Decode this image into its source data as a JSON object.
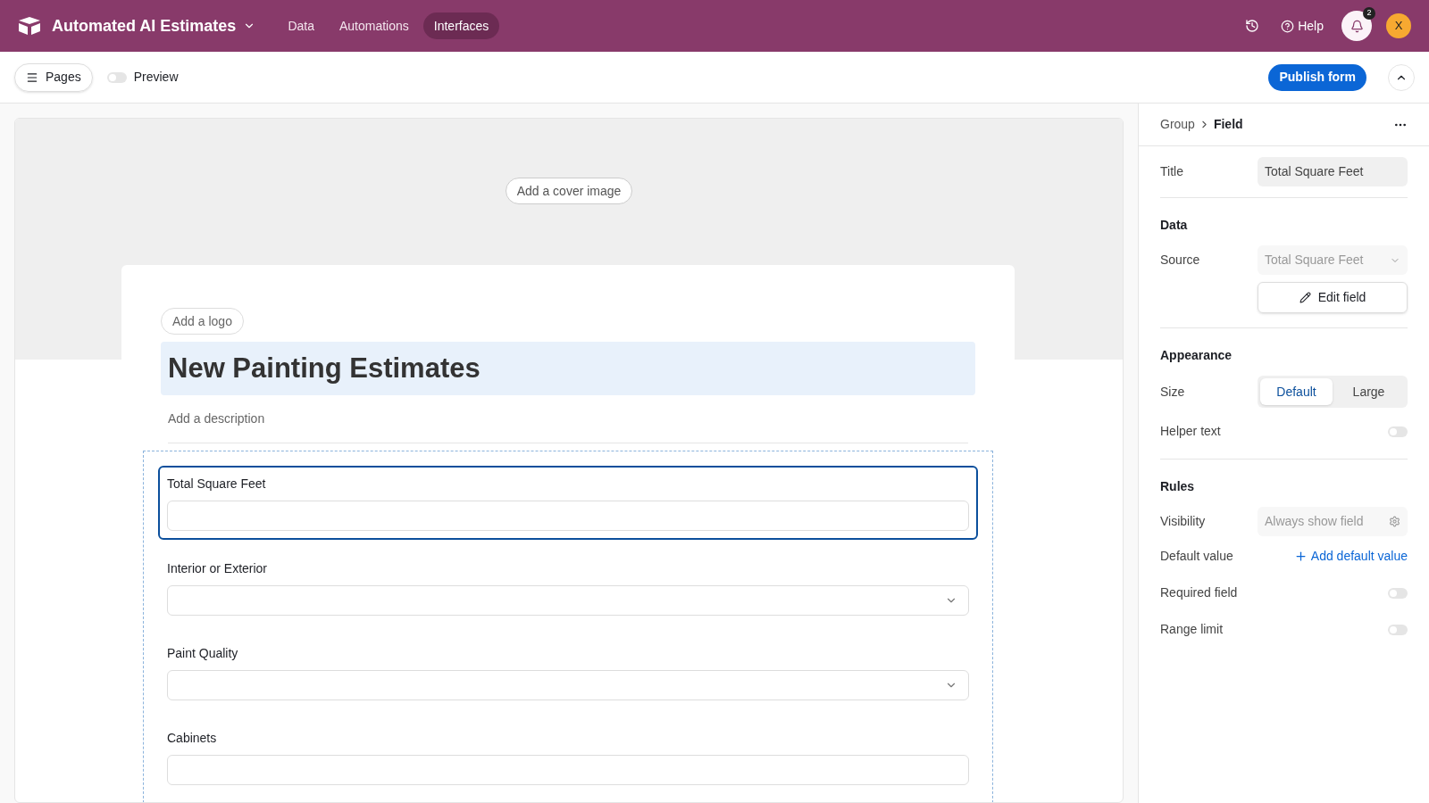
{
  "header": {
    "app_name": "Automated AI Estimates",
    "nav": [
      {
        "label": "Data",
        "selected": false
      },
      {
        "label": "Automations",
        "selected": false
      },
      {
        "label": "Interfaces",
        "selected": true
      }
    ],
    "help": "Help",
    "notification_count": "2",
    "avatar": "X"
  },
  "toolbar": {
    "pages": "Pages",
    "preview": {
      "label": "Preview",
      "on": false
    },
    "publish": "Publish form"
  },
  "form": {
    "cover_button": "Add a cover image",
    "logo_button": "Add a logo",
    "title": "New Painting Estimates",
    "description_placeholder": "Add a description",
    "fields": [
      {
        "label": "Total Square Feet",
        "kind": "text",
        "selected": true
      },
      {
        "label": "Interior or Exterior",
        "kind": "select",
        "selected": false
      },
      {
        "label": "Paint Quality",
        "kind": "select",
        "selected": false
      },
      {
        "label": "Cabinets",
        "kind": "text",
        "selected": false
      }
    ]
  },
  "panel": {
    "breadcrumb": [
      "Group",
      "Field"
    ],
    "title_label": "Title",
    "title_value": "Total Square Feet",
    "data_heading": "Data",
    "source_label": "Source",
    "source_value": "Total Square Feet",
    "edit_field": "Edit field",
    "appearance_heading": "Appearance",
    "size_label": "Size",
    "size_options": [
      {
        "label": "Default",
        "selected": true
      },
      {
        "label": "Large",
        "selected": false
      }
    ],
    "helper_text": {
      "label": "Helper text",
      "on": false
    },
    "rules_heading": "Rules",
    "visibility_label": "Visibility",
    "visibility_value": "Always show field",
    "default_value_label": "Default value",
    "add_default_value": "Add default value",
    "toggles": [
      {
        "label": "Required field",
        "on": false
      },
      {
        "label": "Range limit",
        "on": false
      }
    ]
  }
}
